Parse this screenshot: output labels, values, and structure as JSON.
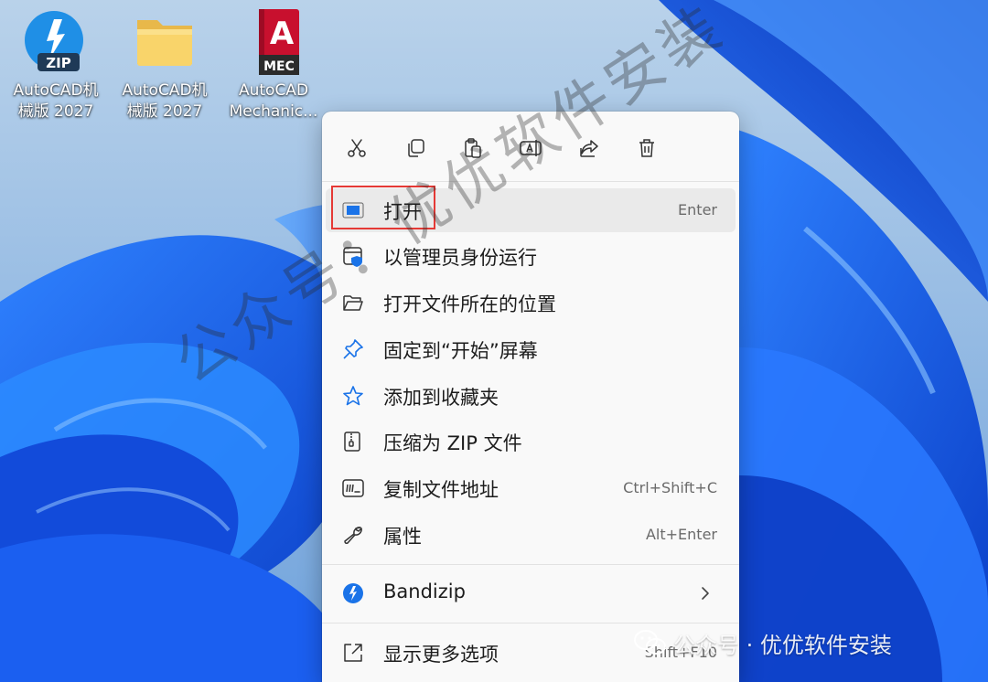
{
  "desktop": {
    "icons": [
      {
        "name": "AutoCAD机\n械版 2027",
        "type": "zip",
        "badge": "ZIP"
      },
      {
        "name": "AutoCAD机\n械版 2027",
        "type": "folder"
      },
      {
        "name": "AutoCAD\nMechanic...",
        "type": "app",
        "logo_letter": "A",
        "badge": "MEC"
      }
    ]
  },
  "context_menu": {
    "toolbar": [
      {
        "icon": "cut-icon"
      },
      {
        "icon": "copy-icon"
      },
      {
        "icon": "paste-icon"
      },
      {
        "icon": "rename-icon"
      },
      {
        "icon": "share-icon"
      },
      {
        "icon": "delete-icon"
      }
    ],
    "items": [
      {
        "label": "打开",
        "shortcut": "Enter",
        "icon": "open-app-icon",
        "highlighted": true
      },
      {
        "label": "以管理员身份运行",
        "shortcut": "",
        "icon": "admin-shield-icon"
      },
      {
        "label": "打开文件所在的位置",
        "shortcut": "",
        "icon": "folder-open-icon"
      },
      {
        "label": "固定到“开始”屏幕",
        "shortcut": "",
        "icon": "pin-icon"
      },
      {
        "label": "添加到收藏夹",
        "shortcut": "",
        "icon": "star-icon"
      },
      {
        "label": "压缩为 ZIP 文件",
        "shortcut": "",
        "icon": "zip-icon"
      },
      {
        "label": "复制文件地址",
        "shortcut": "Ctrl+Shift+C",
        "icon": "copy-path-icon"
      },
      {
        "label": "属性",
        "shortcut": "Alt+Enter",
        "icon": "wrench-icon"
      }
    ],
    "bandizip": {
      "label": "Bandizip",
      "icon": "bandizip-icon"
    },
    "more": {
      "label": "显示更多选项",
      "shortcut": "Shift+F10",
      "icon": "more-options-icon"
    }
  },
  "watermarks": {
    "diagonal": "公众号：优优软件安装",
    "footer": "公众号 · 优优软件安装"
  },
  "colors": {
    "accent": "#1a73e8",
    "highlight_border": "#e53935",
    "wallpaper": "#1f5ce6",
    "menu_bg": "#f9f9f9"
  }
}
